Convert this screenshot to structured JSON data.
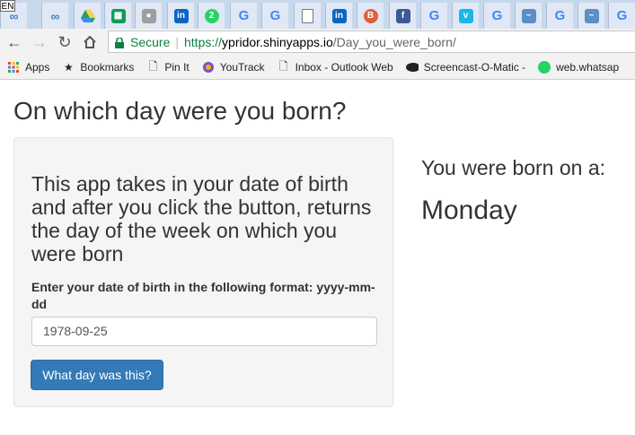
{
  "browser": {
    "lang_indicator": "EN",
    "tabs": [
      {
        "icon": "link-icon"
      },
      {
        "icon": "link-icon"
      },
      {
        "icon": "google-drive-icon"
      },
      {
        "icon": "google-sheets-icon"
      },
      {
        "icon": "app-icon"
      },
      {
        "icon": "linkedin-icon"
      },
      {
        "icon": "whatsapp-icon"
      },
      {
        "icon": "google-icon"
      },
      {
        "icon": "google-icon"
      },
      {
        "icon": "document-icon"
      },
      {
        "icon": "linkedin-icon"
      },
      {
        "icon": "blogger-icon"
      },
      {
        "icon": "facebook-icon"
      },
      {
        "icon": "google-icon"
      },
      {
        "icon": "vimeo-icon"
      },
      {
        "icon": "google-icon"
      },
      {
        "icon": "app-icon"
      },
      {
        "icon": "google-icon"
      },
      {
        "icon": "app-icon"
      },
      {
        "icon": "google-icon"
      }
    ],
    "address": {
      "secure_label": "Secure",
      "scheme": "https://",
      "host": "ypridor.shinyapps.io",
      "path": "/Day_you_were_born/"
    },
    "bookmarks": [
      {
        "label": "Apps",
        "icon": "apps-grid-icon"
      },
      {
        "label": "Bookmarks",
        "icon": "star-icon"
      },
      {
        "label": "Pin It",
        "icon": "page-icon"
      },
      {
        "label": "YouTrack",
        "icon": "youtrack-icon"
      },
      {
        "label": "Inbox - Outlook Web",
        "icon": "page-icon"
      },
      {
        "label": "Screencast-O-Matic -",
        "icon": "screencast-icon"
      },
      {
        "label": "web.whatsap",
        "icon": "whatsapp-icon"
      }
    ]
  },
  "app": {
    "title": "On which day were you born?",
    "description": "This app takes in your date of birth and after you click the button, returns the day of the week on which you were born",
    "input_label": "Enter your date of birth in the following format: yyyy-mm-dd",
    "input_value": "1978-09-25",
    "button_label": "What day was this?",
    "result_label": "You were born on a:",
    "result_value": "Monday"
  },
  "colors": {
    "primary_button": "#337ab7",
    "secure_green": "#0b8043"
  }
}
